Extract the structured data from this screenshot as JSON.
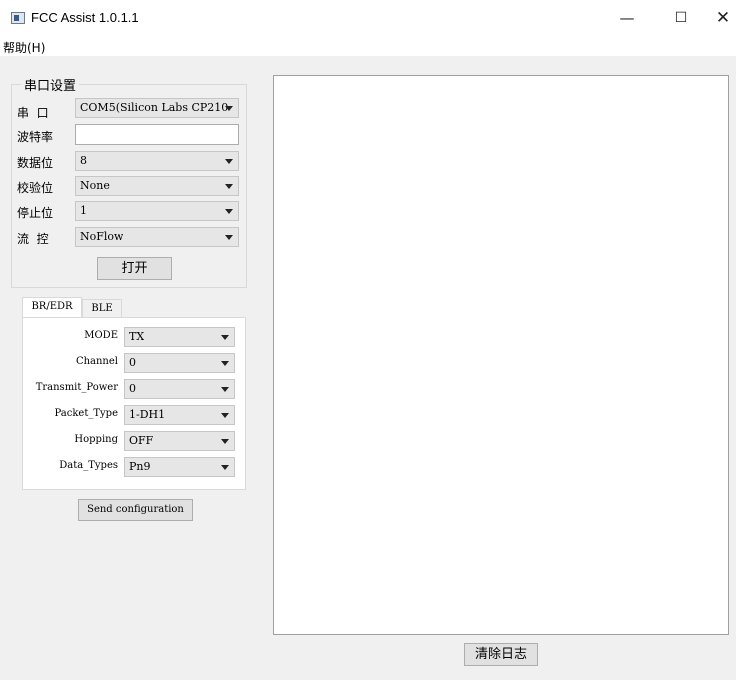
{
  "window": {
    "title": "FCC Assist 1.0.1.1",
    "minimize_glyph": "—",
    "maximize_glyph": "☐",
    "close_glyph": "✕"
  },
  "menu": {
    "help": "帮助(H)"
  },
  "serial": {
    "group_title": "串口设置",
    "port_label": "串  口",
    "port_value": "COM5(Silicon Labs CP210",
    "baud_label": "波特率",
    "baud_value": "",
    "databits_label": "数据位",
    "databits_value": "8",
    "parity_label": "校验位",
    "parity_value": "None",
    "stopbits_label": "停止位",
    "stopbits_value": "1",
    "flow_label": "流  控",
    "flow_value": "NoFlow",
    "open_button": "打开"
  },
  "tabs": [
    {
      "label": "BR/EDR",
      "active": true
    },
    {
      "label": "BLE",
      "active": false
    }
  ],
  "config": {
    "fields": [
      {
        "label": "MODE",
        "value": "TX"
      },
      {
        "label": "Channel",
        "value": "0"
      },
      {
        "label": "Transmit_Power",
        "value": "0"
      },
      {
        "label": "Packet_Type",
        "value": "1-DH1"
      },
      {
        "label": "Hopping",
        "value": "OFF"
      },
      {
        "label": "Data_Types",
        "value": "Pn9"
      }
    ],
    "send_button": "Send configuration"
  },
  "log": {
    "clear_button": "清除日志"
  }
}
